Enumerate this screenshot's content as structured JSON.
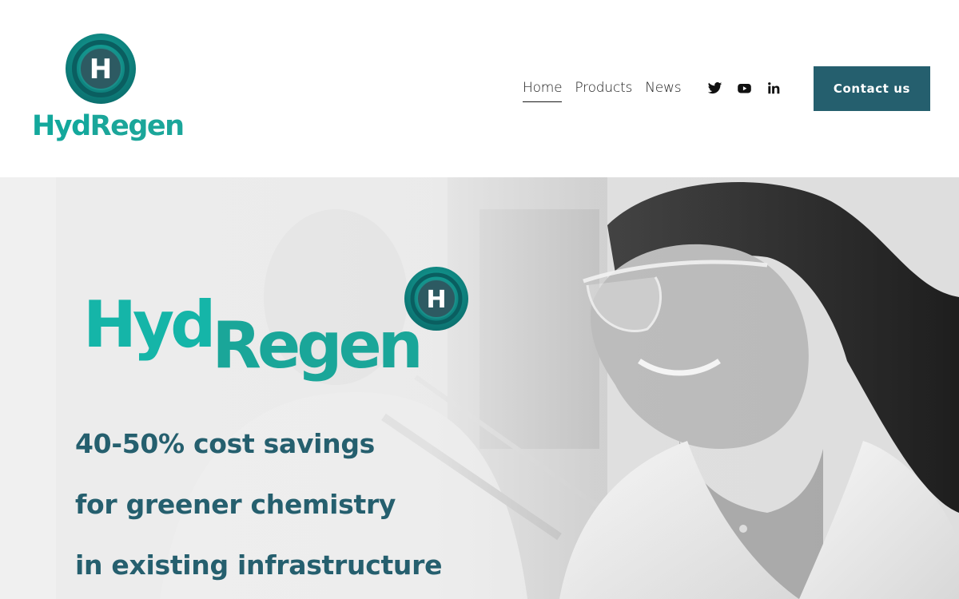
{
  "header": {
    "logo": {
      "word_part1": "Hyd",
      "word_part2": "Regen",
      "badge_letter": "H"
    },
    "nav": [
      {
        "label": "Home",
        "active": true
      },
      {
        "label": "Products",
        "active": false
      },
      {
        "label": "News",
        "active": false
      }
    ],
    "social": [
      {
        "icon": "twitter-icon"
      },
      {
        "icon": "youtube-icon"
      },
      {
        "icon": "linkedin-icon"
      }
    ],
    "contact_label": "Contact us"
  },
  "hero": {
    "logo": {
      "word_part1": "Hyd",
      "word_part2": "Regen",
      "badge_letter": "H"
    },
    "tagline": [
      "40-50% cost savings",
      "for greener chemistry",
      "in existing infrastructure"
    ]
  },
  "colors": {
    "brand_dark": "#255f6e",
    "brand_teal": "#15b5a8",
    "badge_teal": "#0f7f7c",
    "button_bg": "#255f6e"
  }
}
